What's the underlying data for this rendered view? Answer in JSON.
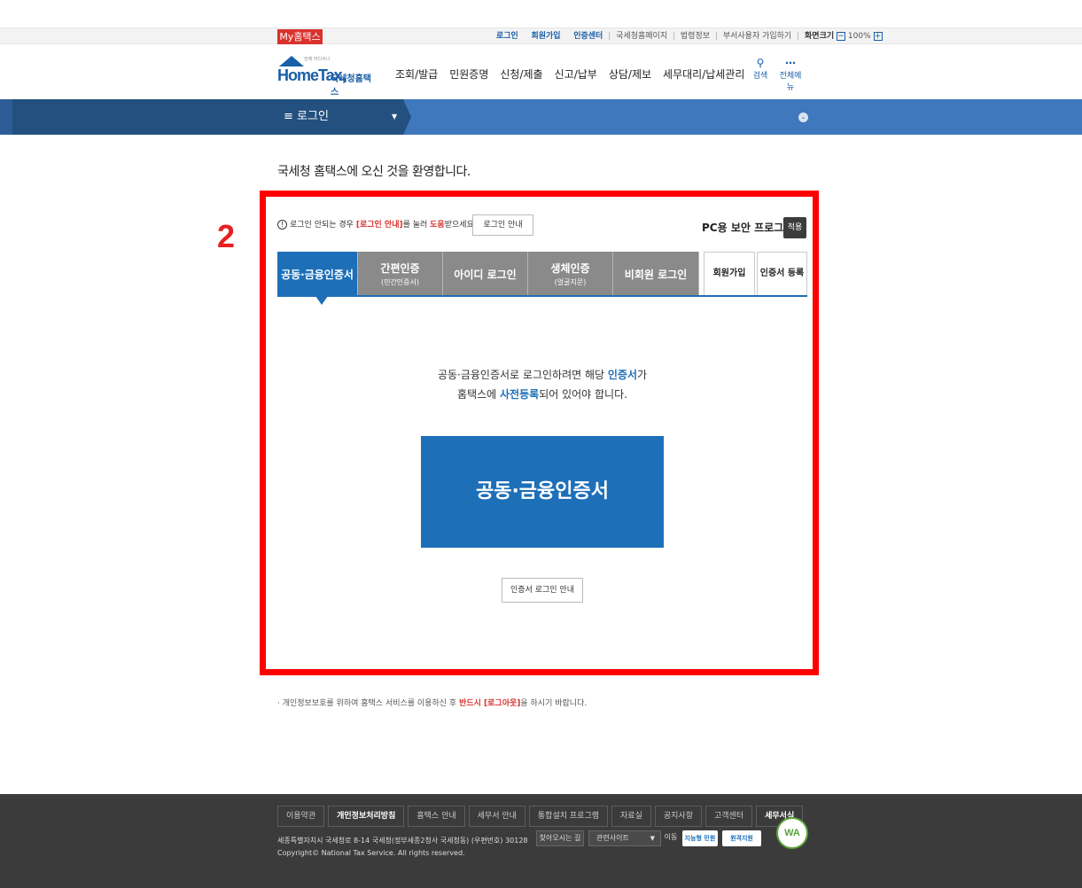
{
  "util": {
    "my_hometax": "My홈택스",
    "login": "로그인",
    "join": "회원가입",
    "cert_center": "인증센터",
    "nts_home": "국세청홈페이지",
    "law_info": "법령정보",
    "dept_join": "부서사용자 가입하기",
    "screen_size": "화면크기",
    "zoom_minus": "−",
    "zoom_value": "100%",
    "zoom_plus": "+"
  },
  "header": {
    "logo_small": "언제 어디서나",
    "logo_brand": "Hom​eTax,",
    "logo_kr": "국세청홈택스",
    "nav": [
      "조회/발급",
      "민원증명",
      "신청/제출",
      "신고/납부",
      "상담/제보",
      "세무대리/납세관리"
    ],
    "search_label": "검색",
    "all_menu_label": "전체메뉴"
  },
  "bluebar": {
    "menu_label": "≡  로그인"
  },
  "welcome": "국세청 홈택스에 오신 것을 환영합니다.",
  "annotation_label": "2",
  "notice": {
    "prefix": "로그인 안되는 경우 ",
    "link": "[로그인 안내]",
    "mid": "를 눌러 ",
    "help": "도움",
    "suffix": "받으세요.",
    "guide_button": "로그인 안내"
  },
  "security": {
    "label": "PC용 보안 프로그램",
    "apply": "적용"
  },
  "tabs": [
    {
      "label": "공동·금융인증서",
      "sub": ""
    },
    {
      "label": "간편인증",
      "sub": "(민간인증서)"
    },
    {
      "label": "아이디 로그인",
      "sub": ""
    },
    {
      "label": "생체인증",
      "sub": "(얼굴지문)"
    },
    {
      "label": "비회원 로그인",
      "sub": ""
    }
  ],
  "side_buttons": {
    "join": "회원가입",
    "cert_register": "인증서 등록"
  },
  "cert_desc": {
    "line1_a": "공동·금융인증서로 로그인하려면 해당 ",
    "line1_b": "인증서",
    "line1_c": "가",
    "line2_a": "홈택스에 ",
    "line2_b": "사전등록",
    "line2_c": "되어 있어야 합니다."
  },
  "big_button": "공동·금융인증서",
  "cert_guide_button": "인증서 로그인 안내",
  "privacy_note": {
    "a": "· 개인정보보호를 위하여 홈택스 서비스를 이용하신 후 ",
    "b": "반드시 [로그아웃]",
    "c": "을 하시기 바랍니다."
  },
  "footer": {
    "links": [
      "이용약관",
      "개인정보처리방침",
      "홈택스 안내",
      "세무서 안내",
      "통합설치 프로그램",
      "자료실",
      "공지사항",
      "고객센터",
      "세무서식"
    ],
    "address": "세종특별자치시 국세청로 8-14 국세청(정부세종2청사 국세청동) (우편번호) 30128",
    "directions": "찾아오시는 길",
    "related_sites": "관련사이트",
    "go": "이동",
    "badge1": "지능형 민원",
    "badge2": "원격지원",
    "wa": "WA",
    "copyright": "Copyright© National Tax Service. All rights reserved."
  },
  "colors": {
    "primary_blue": "#1d6fb8",
    "nav_blue": "#2d5d96",
    "annotation_red": "#ff0000",
    "brand_red": "#d9322e"
  }
}
